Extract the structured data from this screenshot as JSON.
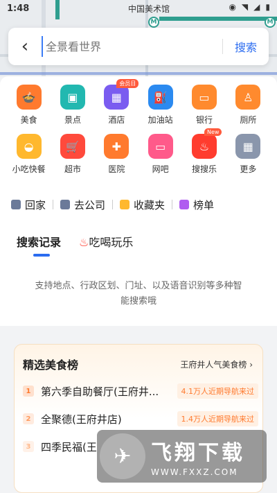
{
  "status": {
    "time": "1:48",
    "location": "中国美术馆",
    "metro_symbol": "M"
  },
  "search": {
    "placeholder": "全景看世界",
    "button": "搜索",
    "back_symbol": "‹"
  },
  "categories": [
    {
      "label": "美食",
      "icon": "food-icon",
      "color": "#ff7a2e",
      "glyph": "🍲"
    },
    {
      "label": "景点",
      "icon": "scenic-icon",
      "color": "#22b8b0",
      "glyph": "▣"
    },
    {
      "label": "酒店",
      "icon": "hotel-icon",
      "color": "#7a5cf0",
      "glyph": "▦",
      "badge": "会员日"
    },
    {
      "label": "加油站",
      "icon": "gas-station-icon",
      "color": "#2b8af0",
      "glyph": "⛽"
    },
    {
      "label": "银行",
      "icon": "bank-icon",
      "color": "#ff8a2e",
      "glyph": "▭"
    },
    {
      "label": "厕所",
      "icon": "toilet-icon",
      "color": "#ff8a2e",
      "glyph": "♙"
    },
    {
      "label": "小吃快餐",
      "icon": "snack-icon",
      "color": "#ffb82e",
      "glyph": "◒"
    },
    {
      "label": "超市",
      "icon": "supermarket-icon",
      "color": "#ff4a3c",
      "glyph": "🛒"
    },
    {
      "label": "医院",
      "icon": "hospital-icon",
      "color": "#ff7a2e",
      "glyph": "✚"
    },
    {
      "label": "网吧",
      "icon": "internet-cafe-icon",
      "color": "#ff5a8a",
      "glyph": "▭"
    },
    {
      "label": "搜搜乐",
      "icon": "fire-icon",
      "color": "#ff3c2e",
      "glyph": "♨",
      "badge": "New"
    },
    {
      "label": "更多",
      "icon": "more-icon",
      "color": "#8a96ac",
      "glyph": "▦"
    }
  ],
  "quick": [
    {
      "label": "回家",
      "icon": "home-icon",
      "color": "#6b7a99"
    },
    {
      "label": "去公司",
      "icon": "company-icon",
      "color": "#6b7a99"
    },
    {
      "label": "收藏夹",
      "icon": "favorites-icon",
      "color": "#ffb82e"
    },
    {
      "label": "榜单",
      "icon": "ranking-icon",
      "color": "#b05cf0"
    }
  ],
  "tabs": {
    "history": "搜索记录",
    "fun": "吃喝玩乐"
  },
  "hint": "支持地点、行政区划、门址、以及语音识别等多种智能搜索哦",
  "food_card": {
    "title": "精选美食榜",
    "more": "王府井人气美食榜 ›",
    "items": [
      {
        "rank": "1",
        "name": "第六季自助餐厅(王府井...",
        "tag": "4.1万人近期导航来过",
        "color": "#ff7a2e"
      },
      {
        "rank": "2",
        "name": "全聚德(王府井店)",
        "tag": "1.4万人近期导航来过",
        "color": "#ff9a5e"
      },
      {
        "rank": "3",
        "name": "四季民福(王",
        "tag": "",
        "color": "#ffb88a"
      }
    ]
  },
  "watermark": {
    "name": "飞翔下载",
    "url": "WWW.FXXZ.COM"
  }
}
